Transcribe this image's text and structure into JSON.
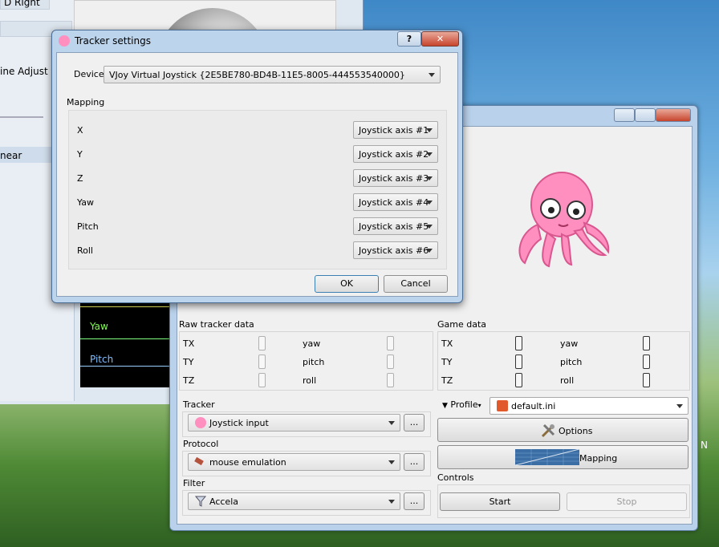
{
  "background_window": {
    "items": [
      "D Right",
      "ine Adjust",
      "near"
    ],
    "graph_labels": [
      "Yaw",
      "Pitch"
    ]
  },
  "dialog": {
    "title": "Tracker settings",
    "help_label": "?",
    "close_label": "✕",
    "device_label": "Device",
    "device_value": "VJoy Virtual Joystick {2E5BE780-BD4B-11E5-8005-444553540000}",
    "mapping_label": "Mapping",
    "rows": [
      {
        "axis": "X",
        "value": "Joystick axis #1"
      },
      {
        "axis": "Y",
        "value": "Joystick axis #2"
      },
      {
        "axis": "Z",
        "value": "Joystick axis #3"
      },
      {
        "axis": "Yaw",
        "value": "Joystick axis #4"
      },
      {
        "axis": "Pitch",
        "value": "Joystick axis #5"
      },
      {
        "axis": "Roll",
        "value": "Joystick axis #6"
      }
    ],
    "ok_label": "OK",
    "cancel_label": "Cancel"
  },
  "main": {
    "raw_title": "Raw tracker data",
    "game_title": "Game data",
    "raw_rows": [
      {
        "left": "TX",
        "right": "yaw"
      },
      {
        "left": "TY",
        "right": "pitch"
      },
      {
        "left": "TZ",
        "right": "roll"
      }
    ],
    "game_rows": [
      {
        "left": "TX",
        "right": "yaw"
      },
      {
        "left": "TY",
        "right": "pitch"
      },
      {
        "left": "TZ",
        "right": "roll"
      }
    ],
    "tracker_label": "Tracker",
    "tracker_value": "Joystick input",
    "protocol_label": "Protocol",
    "protocol_value": "mouse emulation",
    "filter_label": "Filter",
    "filter_value": "Accela",
    "dots_label": "...",
    "profile_label": "Profile",
    "profile_value": "default.ini",
    "options_label": "Options",
    "mapping_label": "Mapping",
    "controls_label": "Controls",
    "start_label": "Start",
    "stop_label": "Stop",
    "stray_text": "N"
  },
  "colors": {
    "octopus": "#ff8fbf",
    "accent": "#3a6ea5"
  }
}
